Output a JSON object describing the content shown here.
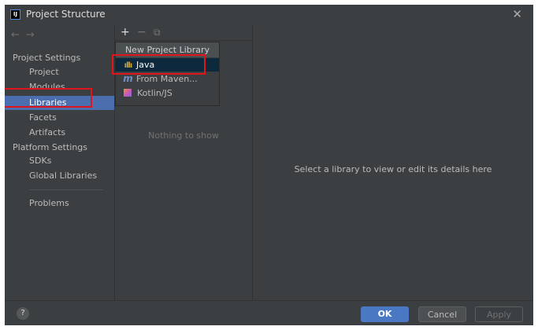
{
  "window": {
    "title": "Project Structure",
    "app_logo": "IJ"
  },
  "sidebar": {
    "sections": [
      {
        "label": "Project Settings",
        "items": [
          "Project",
          "Modules",
          "Libraries",
          "Facets",
          "Artifacts"
        ]
      },
      {
        "label": "Platform Settings",
        "items": [
          "SDKs",
          "Global Libraries"
        ]
      }
    ],
    "extra_items": [
      "Problems"
    ],
    "selected": "Libraries"
  },
  "toolbar": {
    "add": "+",
    "remove": "−",
    "copy": "⧉"
  },
  "library_list": {
    "empty_text": "Nothing to show"
  },
  "popup": {
    "title": "New Project Library",
    "items": [
      {
        "label": "Java",
        "icon": "java-library-icon"
      },
      {
        "label": "From Maven...",
        "icon": "maven-icon"
      },
      {
        "label": "Kotlin/JS",
        "icon": "kotlin-icon"
      }
    ],
    "selected": "Java"
  },
  "details": {
    "message": "Select a library to view or edit its details here"
  },
  "buttons": {
    "help": "?",
    "ok": "OK",
    "cancel": "Cancel",
    "apply": "Apply"
  },
  "highlight_color": "#e0141b"
}
